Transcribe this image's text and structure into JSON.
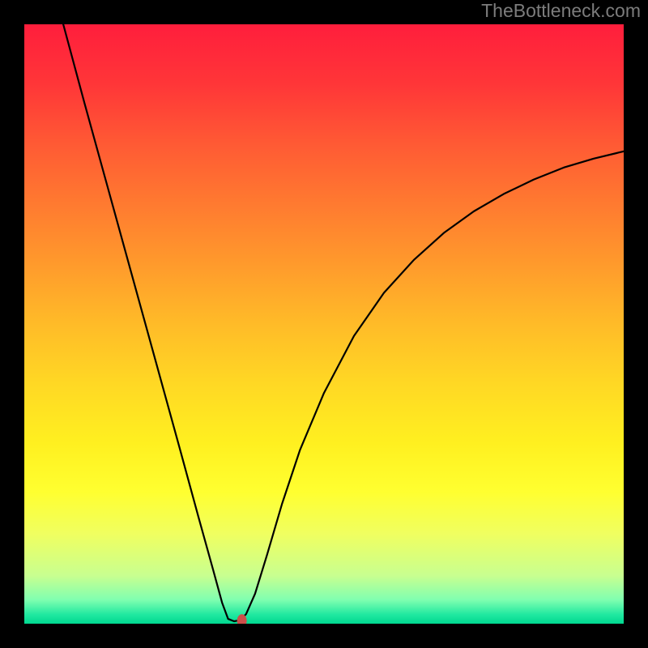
{
  "watermark": "TheBottleneck.com",
  "chart_data": {
    "type": "line",
    "title": "",
    "xlabel": "",
    "ylabel": "",
    "xlim": [
      0,
      100
    ],
    "ylim": [
      0,
      100
    ],
    "grid": false,
    "background_gradient": [
      {
        "offset": 0.0,
        "color": "#ff1e3c"
      },
      {
        "offset": 0.1,
        "color": "#ff3638"
      },
      {
        "offset": 0.2,
        "color": "#ff5a34"
      },
      {
        "offset": 0.3,
        "color": "#ff7a30"
      },
      {
        "offset": 0.4,
        "color": "#ff9a2c"
      },
      {
        "offset": 0.5,
        "color": "#ffbb28"
      },
      {
        "offset": 0.6,
        "color": "#ffd824"
      },
      {
        "offset": 0.7,
        "color": "#fff020"
      },
      {
        "offset": 0.78,
        "color": "#ffff30"
      },
      {
        "offset": 0.85,
        "color": "#f0ff60"
      },
      {
        "offset": 0.92,
        "color": "#c8ff90"
      },
      {
        "offset": 0.96,
        "color": "#80ffb0"
      },
      {
        "offset": 0.985,
        "color": "#20e8a0"
      },
      {
        "offset": 1.0,
        "color": "#00d890"
      }
    ],
    "series": [
      {
        "name": "curve",
        "color": "#000000",
        "width": 2.2,
        "points": [
          {
            "x": 6.5,
            "y": 100.0
          },
          {
            "x": 10.0,
            "y": 87.0
          },
          {
            "x": 14.0,
            "y": 72.5
          },
          {
            "x": 18.0,
            "y": 58.0
          },
          {
            "x": 22.0,
            "y": 43.5
          },
          {
            "x": 26.0,
            "y": 29.0
          },
          {
            "x": 29.0,
            "y": 18.0
          },
          {
            "x": 31.5,
            "y": 9.0
          },
          {
            "x": 33.0,
            "y": 3.5
          },
          {
            "x": 34.0,
            "y": 0.8
          },
          {
            "x": 35.0,
            "y": 0.4
          },
          {
            "x": 36.0,
            "y": 0.6
          },
          {
            "x": 37.0,
            "y": 1.6
          },
          {
            "x": 38.5,
            "y": 5.0
          },
          {
            "x": 40.5,
            "y": 11.5
          },
          {
            "x": 43.0,
            "y": 20.0
          },
          {
            "x": 46.0,
            "y": 29.0
          },
          {
            "x": 50.0,
            "y": 38.5
          },
          {
            "x": 55.0,
            "y": 48.0
          },
          {
            "x": 60.0,
            "y": 55.2
          },
          {
            "x": 65.0,
            "y": 60.7
          },
          {
            "x": 70.0,
            "y": 65.2
          },
          {
            "x": 75.0,
            "y": 68.8
          },
          {
            "x": 80.0,
            "y": 71.7
          },
          {
            "x": 85.0,
            "y": 74.1
          },
          {
            "x": 90.0,
            "y": 76.1
          },
          {
            "x": 95.0,
            "y": 77.6
          },
          {
            "x": 100.0,
            "y": 78.8
          }
        ]
      }
    ],
    "markers": [
      {
        "name": "min-point",
        "x": 36.3,
        "y": 0.5,
        "rx": 6,
        "ry": 8,
        "color": "#cc4f4a"
      }
    ]
  }
}
